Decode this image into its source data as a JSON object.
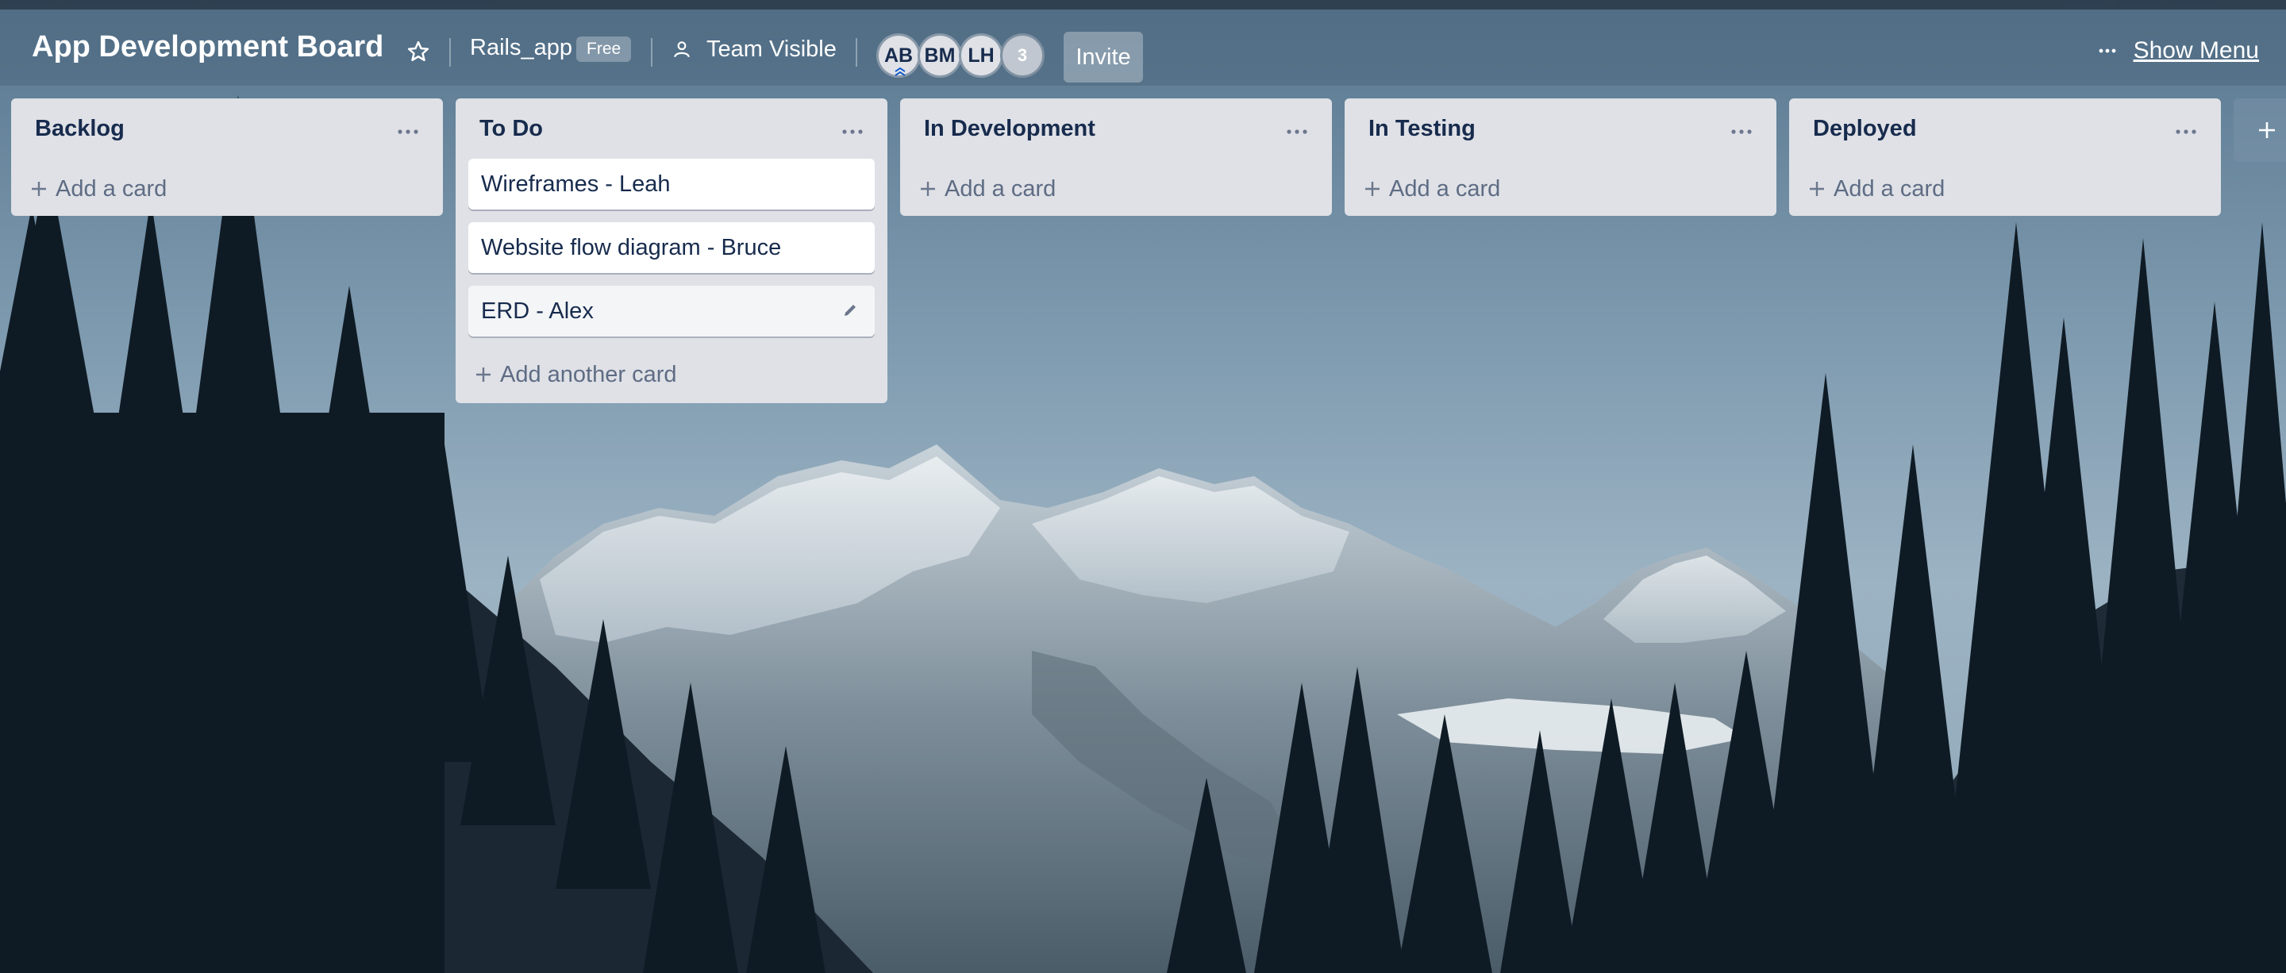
{
  "board": {
    "title": "App Development Board",
    "team_name": "Rails_app",
    "plan_badge": "Free",
    "visibility_label": "Team Visible",
    "invite_label": "Invite",
    "show_menu_label": "Show Menu"
  },
  "members": [
    {
      "initials": "AB"
    },
    {
      "initials": "BM"
    },
    {
      "initials": "LH"
    }
  ],
  "members_more_count": "3",
  "lists": [
    {
      "title": "Backlog",
      "cards": [],
      "add_label": "Add a card"
    },
    {
      "title": "To Do",
      "cards": [
        {
          "title": "Wireframes - Leah"
        },
        {
          "title": "Website flow diagram - Bruce"
        },
        {
          "title": "ERD - Alex"
        }
      ],
      "add_label": "Add another card"
    },
    {
      "title": "In Development",
      "cards": [],
      "add_label": "Add a card"
    },
    {
      "title": "In Testing",
      "cards": [],
      "add_label": "Add a card"
    },
    {
      "title": "Deployed",
      "cards": [],
      "add_label": "Add a card"
    }
  ],
  "icons": {
    "star": "star-icon",
    "visibility": "team-visible-icon",
    "list_menu": "ellipsis-icon",
    "add": "plus-icon",
    "edit": "pencil-icon",
    "menu": "ellipsis-icon"
  },
  "colors": {
    "list_bg": "#dfe1e6",
    "card_bg": "#ffffff",
    "text_primary": "#172b4d",
    "text_muted": "#5e6c84",
    "header_text": "#ffffff"
  }
}
